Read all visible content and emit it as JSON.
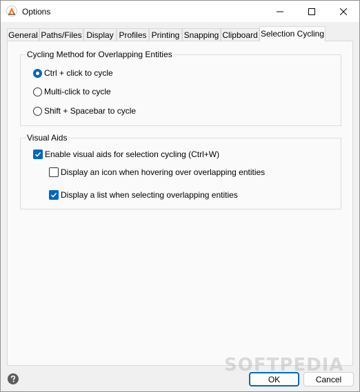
{
  "window": {
    "title": "Options",
    "controls": {
      "minimize": "minimize",
      "maximize": "maximize",
      "close": "close"
    }
  },
  "tabs": [
    {
      "label": "General"
    },
    {
      "label": "Paths/Files"
    },
    {
      "label": "Display"
    },
    {
      "label": "Profiles"
    },
    {
      "label": "Printing"
    },
    {
      "label": "Snapping"
    },
    {
      "label": "Clipboard"
    },
    {
      "label": "Selection Cycling",
      "active": true
    }
  ],
  "cycling_method": {
    "title": "Cycling Method for Overlapping Entities",
    "options": [
      {
        "label": "Ctrl + click to cycle",
        "selected": true
      },
      {
        "label": "Multi-click to cycle",
        "selected": false
      },
      {
        "label": "Shift + Spacebar to cycle",
        "selected": false
      }
    ]
  },
  "visual_aids": {
    "title": "Visual Aids",
    "enable": {
      "label": "Enable visual aids for selection cycling (Ctrl+W)",
      "checked": true
    },
    "icon_hover": {
      "label": "Display an icon when hovering over overlapping entities",
      "checked": false
    },
    "list_select": {
      "label": "Display a list when selecting overlapping entities",
      "checked": true
    }
  },
  "footer": {
    "ok_label": "OK",
    "cancel_label": "Cancel",
    "watermark": "SOFTPEDIA"
  },
  "colors": {
    "accent": "#0067c0",
    "window_bg": "#f0f0f0",
    "panel_bg": "#fafafa"
  }
}
